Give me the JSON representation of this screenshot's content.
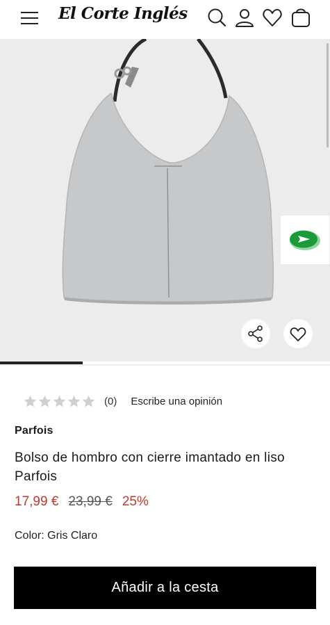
{
  "header": {
    "brand_logo": "El Corte Inglés",
    "icons": [
      "menu-icon",
      "search-icon",
      "user-icon",
      "heart-icon",
      "bag-icon"
    ]
  },
  "gallery": {
    "image_index_progress": 0.25,
    "buttons": [
      "share-icon",
      "heart-icon"
    ],
    "chat_icon": "chat-arrow-icon"
  },
  "rating": {
    "stars_filled": 0,
    "stars_total": 5,
    "count": "(0)",
    "review_link": "Escribe una opinión"
  },
  "product": {
    "brand": "Parfois",
    "title": "Bolso de hombro con cierre imantado en liso Parfois",
    "price": "17,99 €",
    "old_price": "23,99 €",
    "discount": "25%",
    "color": "Color: Gris Claro"
  },
  "cta": {
    "add_to_cart": "Añadir a la cesta"
  },
  "colors": {
    "price": "#c0392b",
    "cta_background": "#000000",
    "chat_green": "#1c9a3a"
  }
}
